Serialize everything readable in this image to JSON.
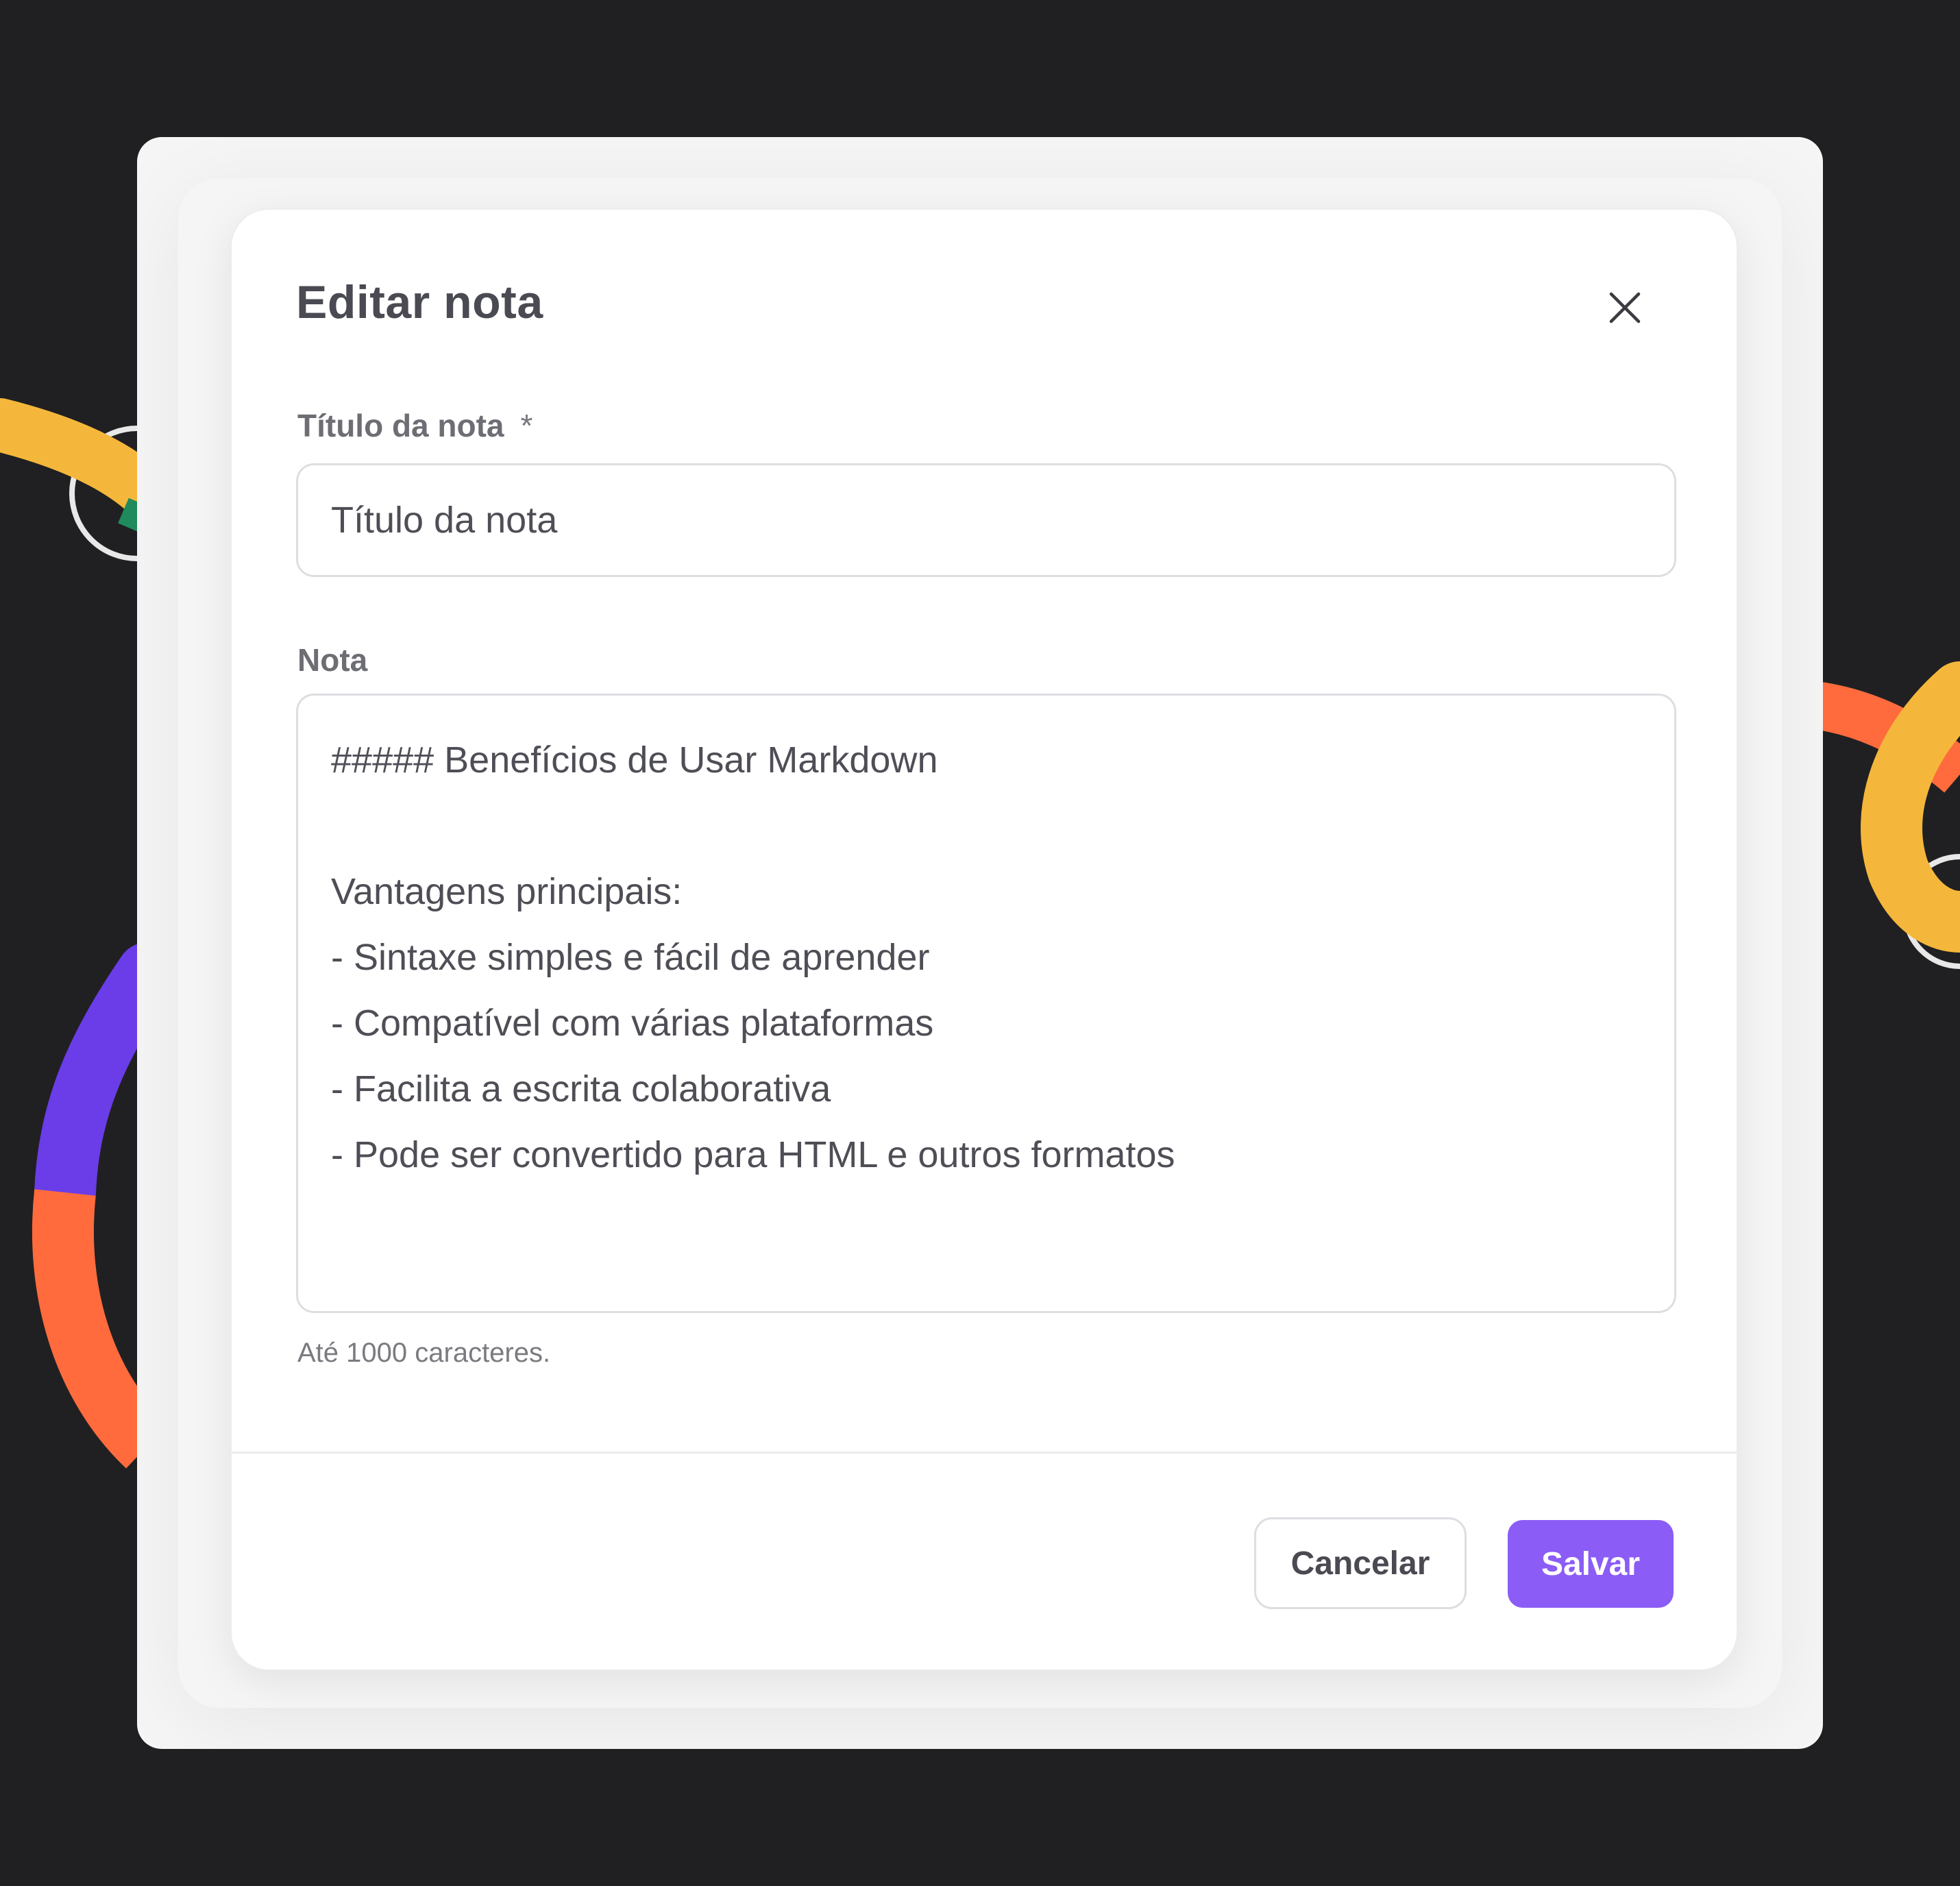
{
  "dialog": {
    "title": "Editar nota",
    "close_icon": "close-icon"
  },
  "title_field": {
    "label": "Título da nota",
    "required_marker": "*",
    "placeholder": "Título da nota",
    "value": ""
  },
  "note_field": {
    "label": "Nota",
    "lines": [
      "##### Benefícios de Usar Markdown",
      "",
      "Vantagens principais:",
      "- Sintaxe simples e fácil de aprender",
      "- Compatível com várias plataformas",
      "- Facilita a escrita colaborativa",
      "- Pode ser convertido para HTML e outros formatos"
    ],
    "hint": "Até 1000 caracteres."
  },
  "actions": {
    "cancel_label": "Cancelar",
    "save_label": "Salvar"
  },
  "colors": {
    "background": "#202022",
    "primary": "#8b5cf6",
    "decor_yellow": "#f5b73b",
    "decor_orange": "#ff6b3d",
    "decor_purple": "#6a3de8",
    "decor_green": "#1f8a5b"
  }
}
